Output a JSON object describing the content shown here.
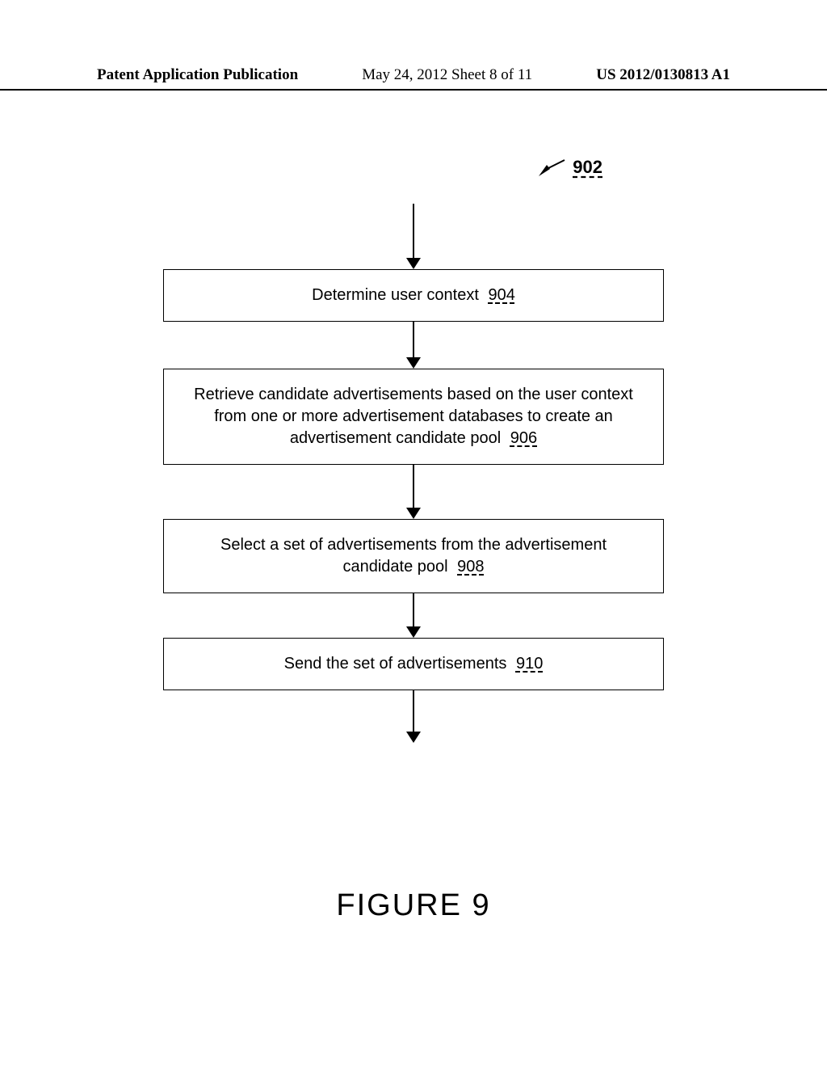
{
  "header": {
    "left": "Patent Application Publication",
    "center": "May 24, 2012  Sheet 8 of 11",
    "right": "US 2012/0130813 A1"
  },
  "reference": "902",
  "steps": [
    {
      "text": "Determine user context",
      "ref": "904"
    },
    {
      "text": "Retrieve candidate advertisements based on the user context from one or more advertisement databases to create an advertisement candidate pool",
      "ref": "906"
    },
    {
      "text": "Select a set of advertisements from the advertisement candidate pool",
      "ref": "908"
    },
    {
      "text": "Send the set of advertisements",
      "ref": "910"
    }
  ],
  "figure_label": "FIGURE 9"
}
